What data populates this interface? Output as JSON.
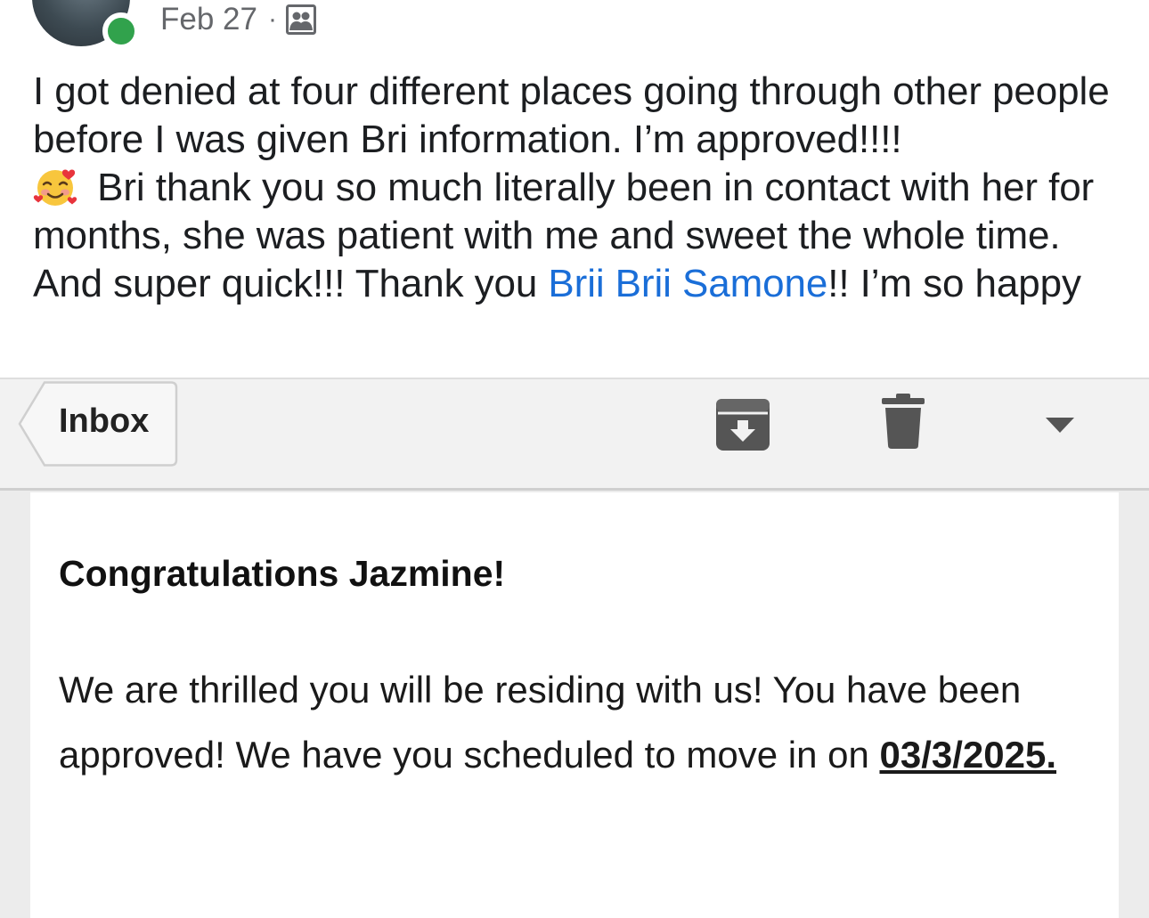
{
  "post": {
    "date": "Feb 27",
    "separator": "·",
    "audience_icon": "friends-audience-icon",
    "text_part1": "I got denied at four different places going through other people before I was given Bri information. I’m approved!!!!",
    "emoji": "smiling-face-with-hearts",
    "text_part2": " Bri thank you so much literally been in contact with her for months, she was patient with me and sweet the whole time. And super quick!!! Thank you ",
    "mention": "Brii Brii Samone",
    "text_part3": "!! I’m so happy",
    "online_status_color": "#31a24c",
    "mention_color": "#1a6ed8"
  },
  "email": {
    "toolbar": {
      "back_label": "Inbox",
      "archive_icon": "archive-icon",
      "trash_icon": "trash-icon",
      "more_icon": "chevron-down-icon"
    },
    "greeting": "Congratulations Jazmine!",
    "message_main": "We are thrilled you will be residing with us! You have been approved! We have you scheduled to move in on ",
    "move_in_date": "03/3/2025."
  }
}
